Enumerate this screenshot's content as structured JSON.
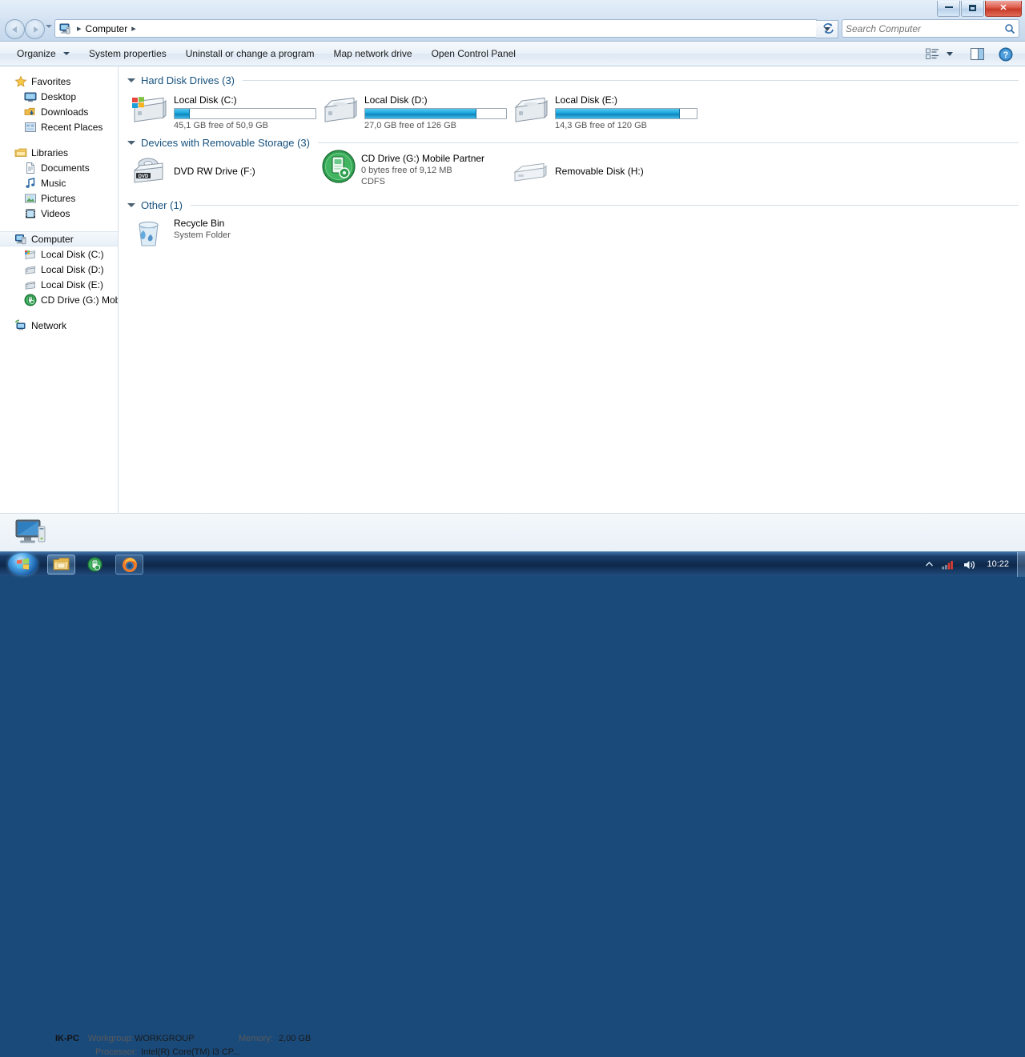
{
  "background": {
    "tabs": [
      {
        "title": "",
        "name": "background-browser-tab-inactive"
      },
      {
        "title": "",
        "name": "background-browser-tab-active"
      }
    ],
    "newtab_label": "+"
  },
  "window": {
    "controls": {
      "minimize_label": "",
      "maximize_label": "",
      "close_label": "✕"
    }
  },
  "address": {
    "breadcrumb": [
      {
        "label": "Computer"
      }
    ],
    "separator": "▸",
    "dropdown_label": "",
    "refresh_label": "↻"
  },
  "search": {
    "placeholder": "Search Computer",
    "value": ""
  },
  "toolbar": {
    "items": [
      {
        "label": "Organize",
        "has_caret": true
      },
      {
        "label": "System properties",
        "has_caret": false
      },
      {
        "label": "Uninstall or change a program",
        "has_caret": false
      },
      {
        "label": "Map network drive",
        "has_caret": false
      },
      {
        "label": "Open Control Panel",
        "has_caret": false
      }
    ],
    "view_label": "",
    "preview_label": "",
    "help_label": "?"
  },
  "sidebar": {
    "groups": [
      {
        "root": {
          "label": "Favorites",
          "icon": "star-icon"
        },
        "children": [
          {
            "label": "Desktop",
            "icon": "desktop-icon"
          },
          {
            "label": "Downloads",
            "icon": "downloads-icon"
          },
          {
            "label": "Recent Places",
            "icon": "recent-places-icon"
          }
        ]
      },
      {
        "root": {
          "label": "Libraries",
          "icon": "libraries-icon"
        },
        "children": [
          {
            "label": "Documents",
            "icon": "documents-icon"
          },
          {
            "label": "Music",
            "icon": "music-icon"
          },
          {
            "label": "Pictures",
            "icon": "pictures-icon"
          },
          {
            "label": "Videos",
            "icon": "videos-icon"
          }
        ]
      },
      {
        "root": {
          "label": "Computer",
          "icon": "computer-icon",
          "selected": true
        },
        "children": [
          {
            "label": "Local Disk (C:)",
            "icon": "windows-drive-icon"
          },
          {
            "label": "Local Disk (D:)",
            "icon": "drive-icon"
          },
          {
            "label": "Local Disk (E:)",
            "icon": "drive-icon"
          },
          {
            "label": "CD Drive (G:) Mobile",
            "icon": "cd-drive-icon"
          }
        ]
      },
      {
        "root": {
          "label": "Network",
          "icon": "network-icon"
        },
        "children": []
      }
    ]
  },
  "main": {
    "groups": [
      {
        "title": "Hard Disk Drives (3)",
        "items": [
          {
            "name": "Local Disk (C:)",
            "sub": "45,1 GB free of 50,9 GB",
            "icon": "windows-hard-drive-icon",
            "meter": true,
            "used_percent": 11
          },
          {
            "name": "Local Disk (D:)",
            "sub": "27,0 GB free of 126 GB",
            "icon": "hard-drive-icon",
            "meter": true,
            "used_percent": 79
          },
          {
            "name": "Local Disk (E:)",
            "sub": "14,3 GB free of 120 GB",
            "icon": "hard-drive-icon",
            "meter": true,
            "used_percent": 88
          }
        ]
      },
      {
        "title": "Devices with Removable Storage (3)",
        "items": [
          {
            "name": "DVD RW Drive (F:)",
            "sub": "",
            "icon": "dvd-drive-icon",
            "meter": false
          },
          {
            "name": "CD Drive (G:) Mobile Partner",
            "sub": "0 bytes free of 9,12 MB",
            "sub2": "CDFS",
            "icon": "cd-drive-green-icon",
            "meter": false
          },
          {
            "name": "Removable Disk (H:)",
            "sub": "",
            "icon": "removable-disk-icon",
            "meter": false
          }
        ]
      },
      {
        "title": "Other (1)",
        "items": [
          {
            "name": "Recycle Bin",
            "sub": "System Folder",
            "icon": "recycle-bin-icon",
            "meter": false
          }
        ]
      }
    ]
  },
  "status": {
    "computer_name": "IK-PC",
    "workgroup_label": "Workgroup:",
    "workgroup_value": "WORKGROUP",
    "memory_label": "Memory:",
    "memory_value": "2,00 GB",
    "processor_label": "Processor:",
    "processor_value": "Intel(R) Core(TM) i3 CP..."
  },
  "taskbar": {
    "start_label": "",
    "buttons": [
      {
        "name": "taskbar-explorer-button",
        "icon": "folder-icon",
        "active": true
      },
      {
        "name": "taskbar-mobile-partner-button",
        "icon": "mobile-partner-icon",
        "active": false
      },
      {
        "name": "taskbar-firefox-button",
        "icon": "firefox-icon",
        "active": false
      }
    ],
    "tray": {
      "show_hidden_label": "▲",
      "network_label": "",
      "volume_label": "",
      "clock": "10:22"
    }
  },
  "colors": {
    "accent": "#15517f",
    "meter_blue": "#19a7dc",
    "close_red": "#c63a28",
    "taskbar_blue": "#0d2648"
  }
}
